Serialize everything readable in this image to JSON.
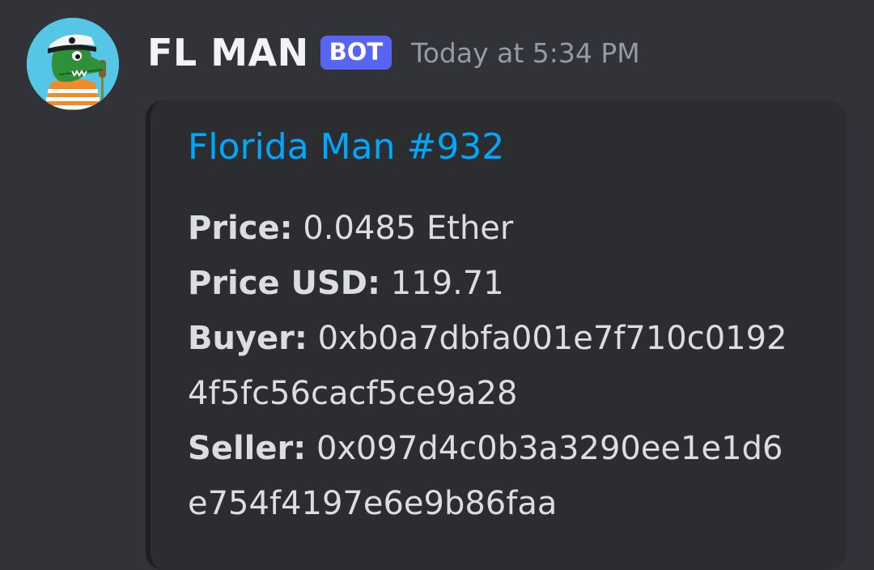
{
  "author": {
    "name": "FL MAN",
    "tag": "BOT",
    "timestamp": "Today at 5:34 PM",
    "avatar_icon": "alligator-captain-avatar"
  },
  "embed": {
    "title": "Florida Man #932",
    "fields": {
      "price_label": "Price:",
      "price_value": "0.0485 Ether",
      "price_usd_label": "Price USD:",
      "price_usd_value": "119.71",
      "buyer_label": "Buyer:",
      "buyer_value_line1": "0xb0a7dbfa001e7f710c0192",
      "buyer_value_line2": "4f5fc56cacf5ce9a28",
      "seller_label": "Seller:",
      "seller_value_line1": "0x097d4c0b3a3290ee1e1d6",
      "seller_value_line2": "e754f4197e6e9b86faa"
    }
  },
  "colors": {
    "background": "#313338",
    "embed_background": "#2b2d31",
    "title_link": "#00a8fc",
    "bot_tag": "#5865f2",
    "timestamp": "#949ba4"
  }
}
